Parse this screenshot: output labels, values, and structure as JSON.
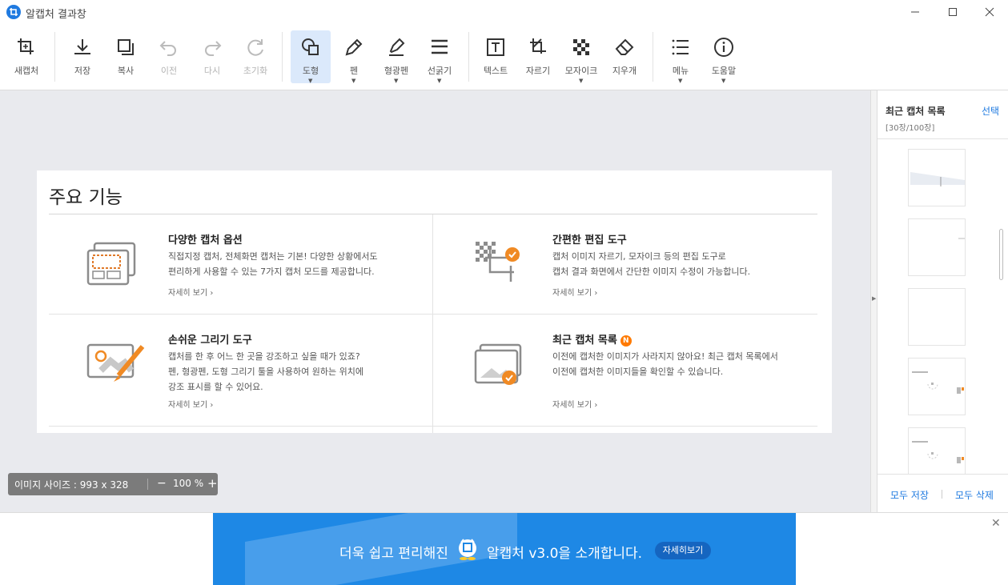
{
  "window": {
    "title": "알캡처 결과창"
  },
  "toolbar": {
    "new_capture": "새캡처",
    "save": "저장",
    "copy": "복사",
    "undo": "이전",
    "redo": "다시",
    "reset": "초기화",
    "shape": "도형",
    "pen": "펜",
    "highlighter": "형광펜",
    "line_width": "선굵기",
    "text": "텍스트",
    "crop": "자르기",
    "mosaic": "모자이크",
    "eraser": "지우개",
    "menu": "메뉴",
    "help": "도움말"
  },
  "card": {
    "title": "주요 기능",
    "more": "자세히 보기 ›",
    "features": [
      {
        "title": "다양한 캡처 옵션",
        "desc1": "직접지정 캡처, 전체화면 캡처는 기본! 다양한 상황에서도",
        "desc2": "편리하게 사용할 수 있는 7가지 캡처 모드를 제공합니다."
      },
      {
        "title": "간편한 편집 도구",
        "desc1": "캡처 이미지 자르기, 모자이크 등의 편집 도구로",
        "desc2": "캡처 결과 화면에서 간단한 이미지 수정이 가능합니다."
      },
      {
        "title": "손쉬운 그리기 도구",
        "desc1": "캡처를 한 후 어느 한 곳을 강조하고 싶을 때가 있죠?",
        "desc2": "펜, 형광펜, 도형 그리기 툴을 사용하여 원하는 위치에",
        "desc3": "강조 표시를 할 수 있어요."
      },
      {
        "title": "최근 캡처 목록",
        "badge": "N",
        "desc1": "이전에 캡처한 이미지가 사라지지 않아요! 최근 캡처 목록에서",
        "desc2": "이전에 캡처한 이미지들을 확인할 수 있습니다."
      }
    ]
  },
  "status": {
    "size_label": "이미지 사이즈 : 993 x 328",
    "zoom": "100 %",
    "minus": "−",
    "plus": "+"
  },
  "recent": {
    "title": "최근 캡처 목록",
    "count": "[30장/100장]",
    "select": "선택",
    "save_all": "모두 저장",
    "delete_all": "모두 삭제"
  },
  "banner": {
    "text_before": "더욱 쉽고 편리해진",
    "text_after": "알캡처 v3.0을 소개합니다.",
    "button": "자세히보기",
    "close": "✕"
  },
  "colors": {
    "accent": "#1f7ae0",
    "badge": "#ff7a00",
    "banner": "#1e88e5"
  }
}
